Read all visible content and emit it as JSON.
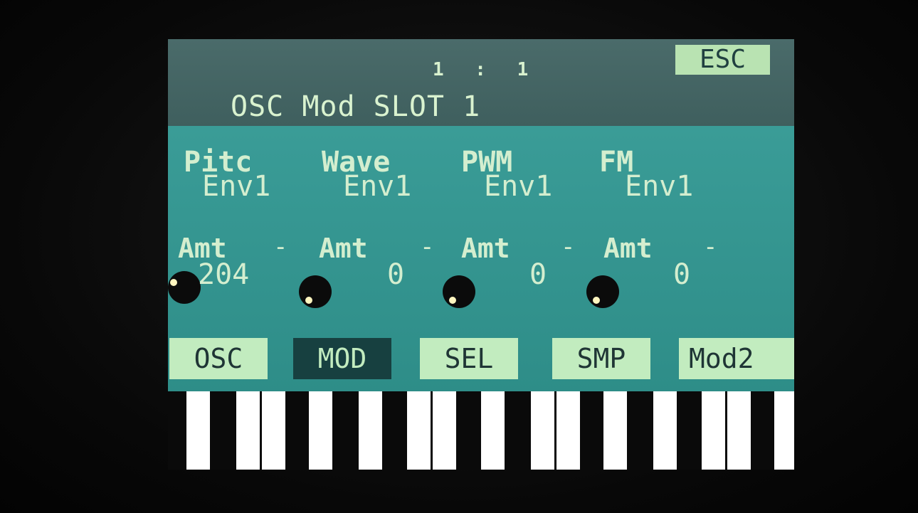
{
  "header": {
    "position": "1 :  1",
    "title": "OSC Mod SLOT 1",
    "esc_label": "ESC"
  },
  "params": [
    {
      "label": "Pitc",
      "value": "Env1"
    },
    {
      "label": "Wave",
      "value": "Env1"
    },
    {
      "label": "PWM",
      "value": "Env1"
    },
    {
      "label": "FM",
      "value": "Env1"
    }
  ],
  "amounts": [
    {
      "label": "Amt",
      "dash": "-",
      "value": "204",
      "knob_icon": "knob-icon"
    },
    {
      "label": "Amt",
      "dash": "-",
      "value": "0",
      "knob_icon": "knob-icon"
    },
    {
      "label": "Amt",
      "dash": "-",
      "value": "0",
      "knob_icon": "knob-icon"
    },
    {
      "label": "Amt",
      "dash": "-",
      "value": "0",
      "knob_icon": "knob-icon"
    }
  ],
  "softkeys": [
    {
      "label": "OSC",
      "active": false
    },
    {
      "label": "MOD",
      "active": true
    },
    {
      "label": "SEL",
      "active": false
    },
    {
      "label": "SMP",
      "active": false
    },
    {
      "label": "Mod2",
      "active": false
    }
  ],
  "colors": {
    "screen_bg": "#2f8f8a",
    "header_bg": "#4a6b6a",
    "text": "#d4eecf",
    "button_bg": "#c2ecbf",
    "button_active_bg": "#174040"
  }
}
